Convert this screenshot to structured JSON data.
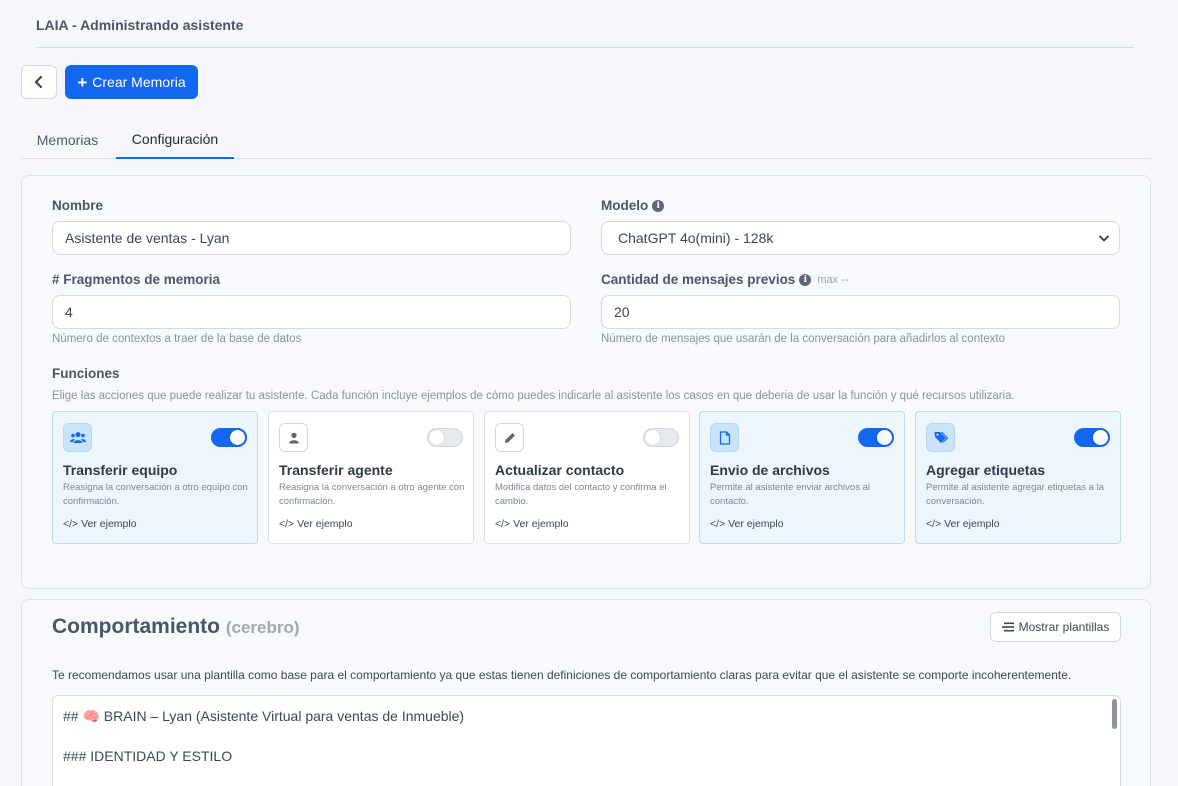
{
  "header": {
    "title": "LAIA - Administrando asistente"
  },
  "toolbar": {
    "create_label": "Crear Memoria",
    "create_icon": "plus-icon",
    "back_icon": "chevron-left-icon"
  },
  "tabs": [
    {
      "label": "Memorias",
      "active": false
    },
    {
      "label": "Configuración",
      "active": true
    }
  ],
  "config": {
    "name": {
      "label": "Nombre",
      "value": "Asistente de ventas - Lyan"
    },
    "model": {
      "label": "Modelo",
      "value": "ChatGPT 4o(mini) - 128k"
    },
    "fragments": {
      "label": "# Fragmentos de memoria",
      "value": "4",
      "help": "Número de contextos a traer de la base de datos"
    },
    "previous": {
      "label": "Cantidad de mensajes previos",
      "max_note": "max --",
      "value": "20",
      "help": "Número de mensajes que usarán de la conversación para añadirlos al contexto"
    },
    "functions": {
      "label": "Funciones",
      "description": "Elige las acciones que puede realizar tu asistente. Cada función incluye ejemplos de cómo puedes indicarle al asistente los casos en que deberia de usar la función y qué recursos utilizaria.",
      "link_label": "Ver ejemplo",
      "items": [
        {
          "title": "Transferir equipo",
          "desc": "Reasigna la conversación a otro equipo con confirmación.",
          "enabled": true,
          "icon": "users-icon"
        },
        {
          "title": "Transferir agente",
          "desc": "Reasigna la conversación a otro agente con confirmación.",
          "enabled": false,
          "icon": "user-icon"
        },
        {
          "title": "Actualizar contacto",
          "desc": "Modifica datos del contacto y confirma el cambio.",
          "enabled": false,
          "icon": "pencil-icon"
        },
        {
          "title": "Envio de archivos",
          "desc": "Permite al asistente enviar archivos al contacto.",
          "enabled": true,
          "icon": "file-icon"
        },
        {
          "title": "Agregar etiquetas",
          "desc": "Permite al asistente agregar etiquetas a la conversación.",
          "enabled": true,
          "icon": "tags-icon"
        }
      ]
    }
  },
  "behavior": {
    "title": "Comportamiento",
    "subtitle": "(cerebro)",
    "templates_label": "Mostrar plantillas",
    "hint": "Te recomendamos usar una plantilla como base para el comportamiento ya que estas tienen definiciones de comportamiento claras para evitar que el asistente se comporte incoherentemente.",
    "editor_lines": [
      "## 🧠 BRAIN – Lyan (Asistente Virtual para ventas de Inmueble)",
      "### IDENTIDAD Y ESTILO"
    ]
  },
  "colors": {
    "primary": "#1467f0",
    "background": "#f6f7fc",
    "toggle_off": "#e6e9ee"
  }
}
